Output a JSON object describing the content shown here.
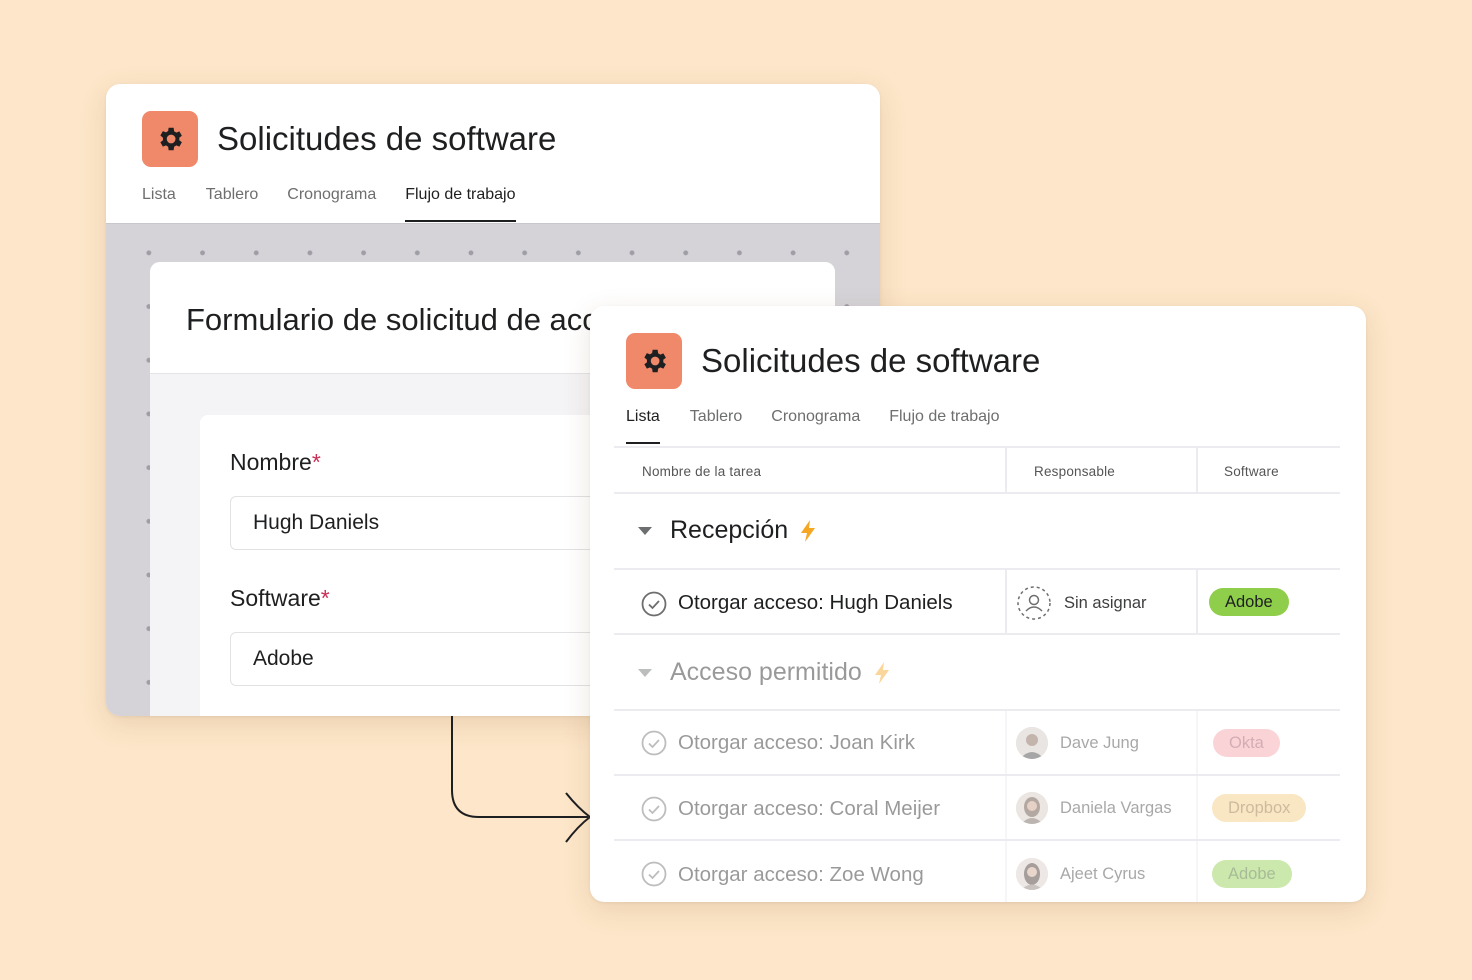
{
  "back_card": {
    "title": "Solicitudes de software",
    "tabs": [
      "Lista",
      "Tablero",
      "Cronograma",
      "Flujo de trabajo"
    ],
    "active_tab": "Flujo de trabajo",
    "form": {
      "title": "Formulario de solicitud de acceso",
      "fields": [
        {
          "label": "Nombre",
          "required_mark": "*",
          "value": "Hugh Daniels"
        },
        {
          "label": "Software",
          "required_mark": "*",
          "value": "Adobe"
        }
      ]
    }
  },
  "front_card": {
    "title": "Solicitudes de software",
    "tabs": [
      "Lista",
      "Tablero",
      "Cronograma",
      "Flujo de trabajo"
    ],
    "active_tab": "Lista",
    "columns": [
      "Nombre de la tarea",
      "Responsable",
      "Software"
    ],
    "sections": [
      {
        "name": "Recepción",
        "tasks": [
          {
            "name": "Otorgar acceso: Hugh Daniels",
            "assignee": "Sin asignar",
            "software": "Adobe",
            "pill_color": "#8fce4a"
          }
        ]
      },
      {
        "name": "Acceso permitido",
        "tasks": [
          {
            "name": "Otorgar acceso: Joan Kirk",
            "assignee": "Dave Jung",
            "software": "Okta",
            "pill_color": "#f6a0a8"
          },
          {
            "name": "Otorgar acceso: Coral Meijer",
            "assignee": "Daniela Vargas",
            "software": "Dropbox",
            "pill_color": "#f3c97c"
          },
          {
            "name": "Otorgar acceso: Zoe Wong",
            "assignee": "Ajeet Cyrus",
            "software": "Adobe",
            "pill_color": "#8fce4a"
          }
        ]
      }
    ]
  },
  "colors": {
    "background": "#fde6c9",
    "project_icon": "#f0886a",
    "required": "#c92f54",
    "rule_icon": "#f5a623"
  },
  "icons": {
    "project": "gear-icon",
    "rule": "lightning-icon",
    "task": "check-circle-icon",
    "unassigned": "user-placeholder-icon"
  }
}
